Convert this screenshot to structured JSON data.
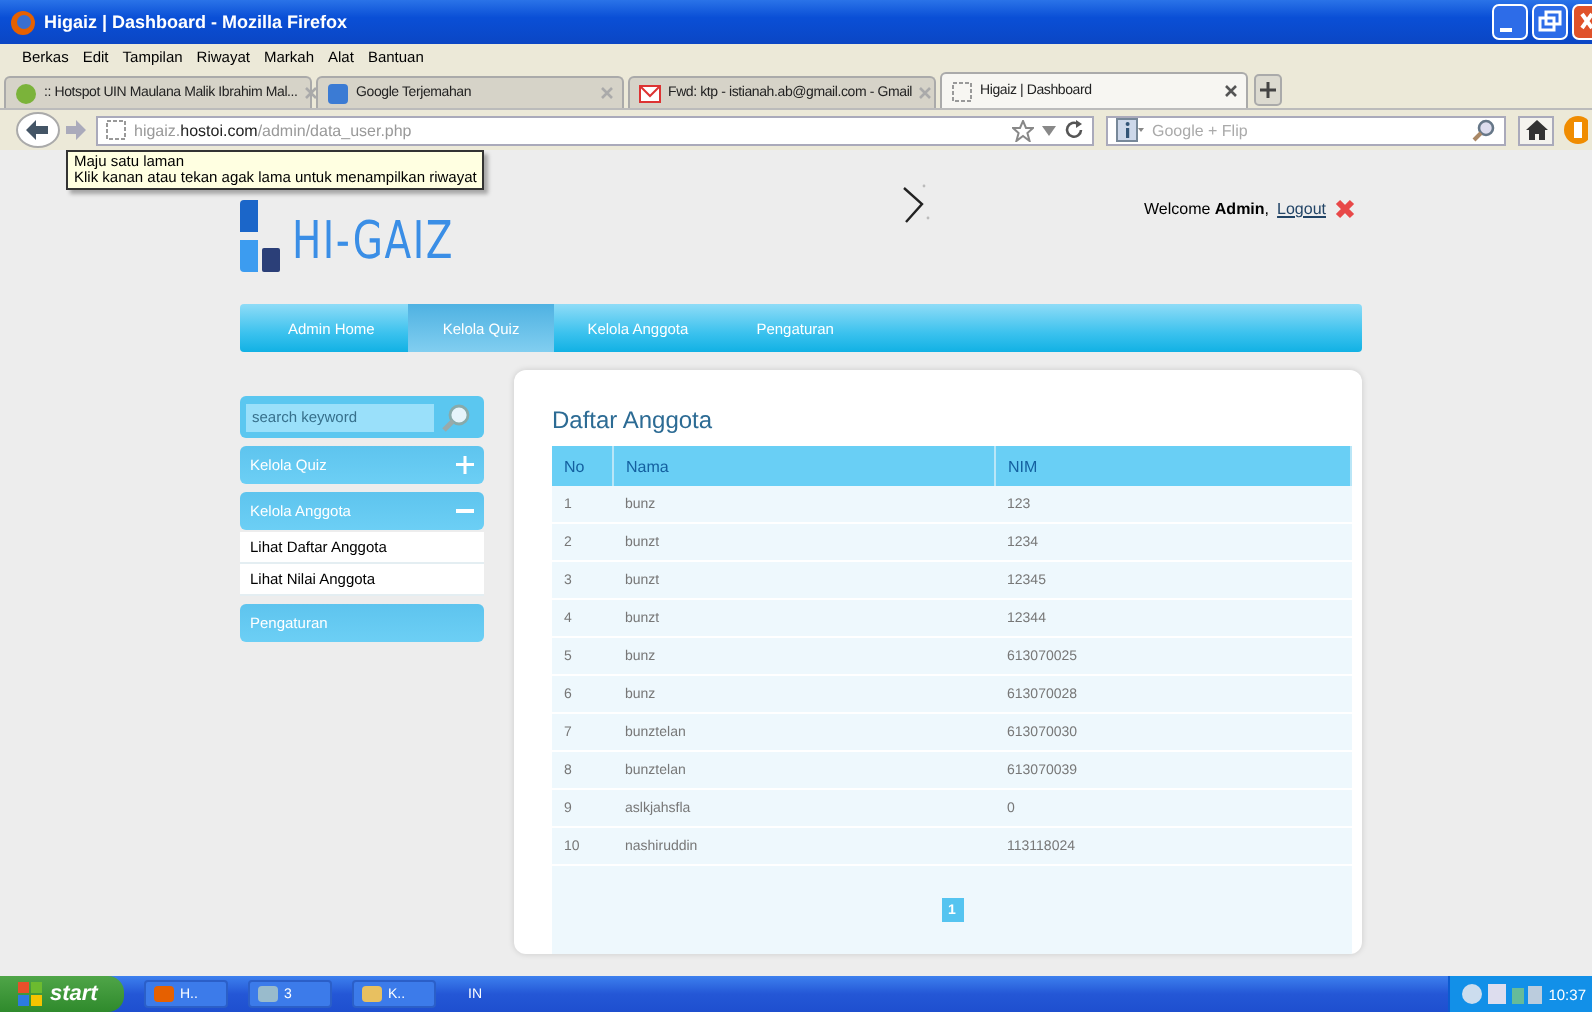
{
  "window": {
    "title": "Higaiz | Dashboard - Mozilla Firefox"
  },
  "menu": [
    "Berkas",
    "Edit",
    "Tampilan",
    "Riwayat",
    "Markah",
    "Alat",
    "Bantuan"
  ],
  "browser_tabs": [
    {
      "label": ":: Hotspot UIN Maulana Malik Ibrahim Mal...",
      "selected": false
    },
    {
      "label": "Google Terjemahan",
      "selected": false
    },
    {
      "label": "Fwd: ktp - istianah.ab@gmail.com - Gmail",
      "selected": false
    },
    {
      "label": "Higaiz | Dashboard",
      "selected": true
    }
  ],
  "address": {
    "url": "higaiz.**hostoi.com**/admin/data_user.php"
  },
  "search": {
    "placeholder": "Google + Flip"
  },
  "tooltip": [
    "Maju satu laman",
    "Klik kanan atau tekan agak lama untuk menampilkan riwayat"
  ],
  "site": {
    "logo": "HI-GAIZ",
    "welcome": "Welcome **Admin**,",
    "logout": "Logout",
    "nav": [
      {
        "label": "Admin Home",
        "selected": false
      },
      {
        "label": "Kelola Quiz",
        "selected": true
      },
      {
        "label": "Kelola Anggota",
        "selected": false
      },
      {
        "label": "Pengaturan",
        "selected": false
      }
    ],
    "sidebar": {
      "search_placeholder": "search keyword",
      "sections": [
        {
          "label": "Kelola Quiz",
          "kind": "group",
          "expanded": false
        },
        {
          "label": "Kelola Anggota",
          "kind": "group",
          "expanded": true,
          "children": [
            "Lihat Daftar Anggota",
            "Lihat Nilai Anggota"
          ]
        },
        {
          "label": "Pengaturan",
          "kind": "link"
        }
      ]
    },
    "content": {
      "title": "Daftar Anggota",
      "columns": [
        "No",
        "Nama",
        "NIM"
      ],
      "rows": [
        [
          "1",
          "bunz",
          "123"
        ],
        [
          "2",
          "bunzt",
          "1234"
        ],
        [
          "3",
          "bunzt",
          "12345"
        ],
        [
          "4",
          "bunzt",
          "12344"
        ],
        [
          "5",
          "bunz",
          "613070025"
        ],
        [
          "6",
          "bunz",
          "613070028"
        ],
        [
          "7",
          "bunztelan",
          "613070030"
        ],
        [
          "8",
          "bunztelan",
          "613070039"
        ],
        [
          "9",
          "aslkjahsfla",
          "0"
        ],
        [
          "10",
          "nashiruddin",
          "113118024"
        ]
      ],
      "pages": [
        {
          "label": "1",
          "selected": true
        }
      ]
    }
  },
  "taskbar": {
    "start": "start",
    "tasks": [
      "H..",
      "3",
      "K.."
    ],
    "language": "IN",
    "clock": "10:37"
  }
}
